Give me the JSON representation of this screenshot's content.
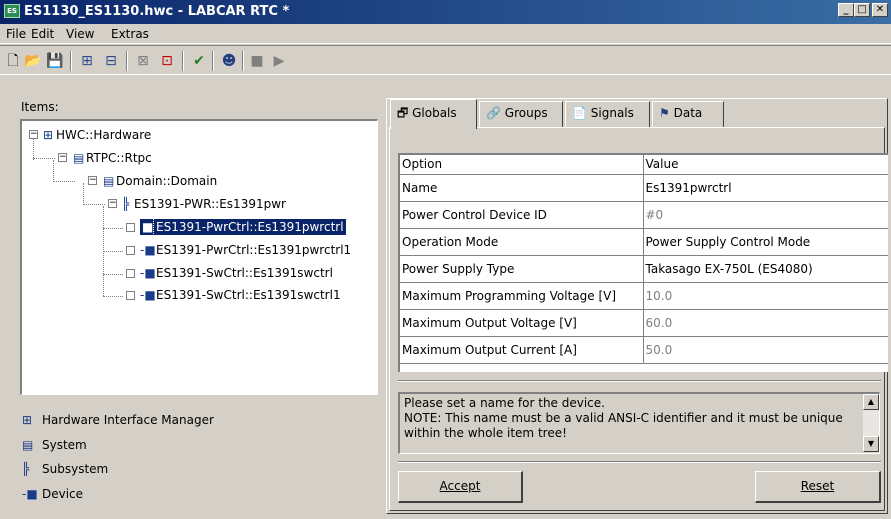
{
  "window": {
    "title": "ES1130_ES1130.hwc - LABCAR RTC  *",
    "app_icon_text": "ES"
  },
  "menu": [
    "File",
    "Edit",
    "View",
    "Extras"
  ],
  "toolbar": {
    "icons": [
      "new-icon",
      "open-icon",
      "save-icon",
      "add-item-icon",
      "add-item-2-icon",
      "cut-item-icon",
      "paste-item-icon",
      "check-icon",
      "user-icon",
      "stop-icon",
      "run-icon"
    ]
  },
  "items_panel": {
    "label": "Items:",
    "tree": [
      {
        "label": "HWC::Hardware",
        "icon": "hardware-icon"
      },
      {
        "label": "RTPC::Rtpc",
        "icon": "system-icon"
      },
      {
        "label": "Domain::Domain",
        "icon": "system-icon"
      },
      {
        "label": "ES1391-PWR::Es1391pwr",
        "icon": "subsystem-icon"
      },
      {
        "label": "ES1391-PwrCtrl::Es1391pwrctrl",
        "icon": "device-icon",
        "selected": true
      },
      {
        "label": "ES1391-PwrCtrl::Es1391pwrctrl1",
        "icon": "device-icon"
      },
      {
        "label": "ES1391-SwCtrl::Es1391swctrl",
        "icon": "device-icon"
      },
      {
        "label": "ES1391-SwCtrl::Es1391swctrl1",
        "icon": "device-icon"
      }
    ]
  },
  "legend": [
    {
      "label": "Hardware Interface Manager",
      "icon": "hardware-icon"
    },
    {
      "label": "System",
      "icon": "system-icon"
    },
    {
      "label": "Subsystem",
      "icon": "subsystem-icon"
    },
    {
      "label": "Device",
      "icon": "device-icon"
    }
  ],
  "tabs": [
    {
      "label": "Globals",
      "icon": "globals-icon",
      "active": true
    },
    {
      "label": "Groups",
      "icon": "groups-icon"
    },
    {
      "label": "Signals",
      "icon": "signals-icon"
    },
    {
      "label": "Data",
      "icon": "data-icon"
    }
  ],
  "grid": {
    "headers": [
      "Option",
      "Value"
    ],
    "rows": [
      {
        "option": "Name",
        "value": "Es1391pwrctrl",
        "disabled": false
      },
      {
        "option": "Power Control Device ID",
        "value": "#0",
        "disabled": true
      },
      {
        "option": "Operation Mode",
        "value": "Power Supply Control Mode",
        "disabled": false
      },
      {
        "option": "Power Supply Type",
        "value": "Takasago EX-750L (ES4080)",
        "disabled": false
      },
      {
        "option": "Maximum Programming Voltage [V]",
        "value": "10.0",
        "disabled": true
      },
      {
        "option": "Maximum Output Voltage [V]",
        "value": "60.0",
        "disabled": true
      },
      {
        "option": "Maximum Output Current [A]",
        "value": "50.0",
        "disabled": true
      }
    ]
  },
  "description": {
    "line1": "Please set a name for the device.",
    "line2": "NOTE: This name must be a valid ANSI-C identifier and it must be unique",
    "line3": "within the whole item tree!"
  },
  "buttons": {
    "accept": "Accept",
    "reset": "Reset"
  },
  "colors": {
    "titlebar": "#0a246a",
    "selection": "#0a246a",
    "face": "#d4d0c8"
  }
}
